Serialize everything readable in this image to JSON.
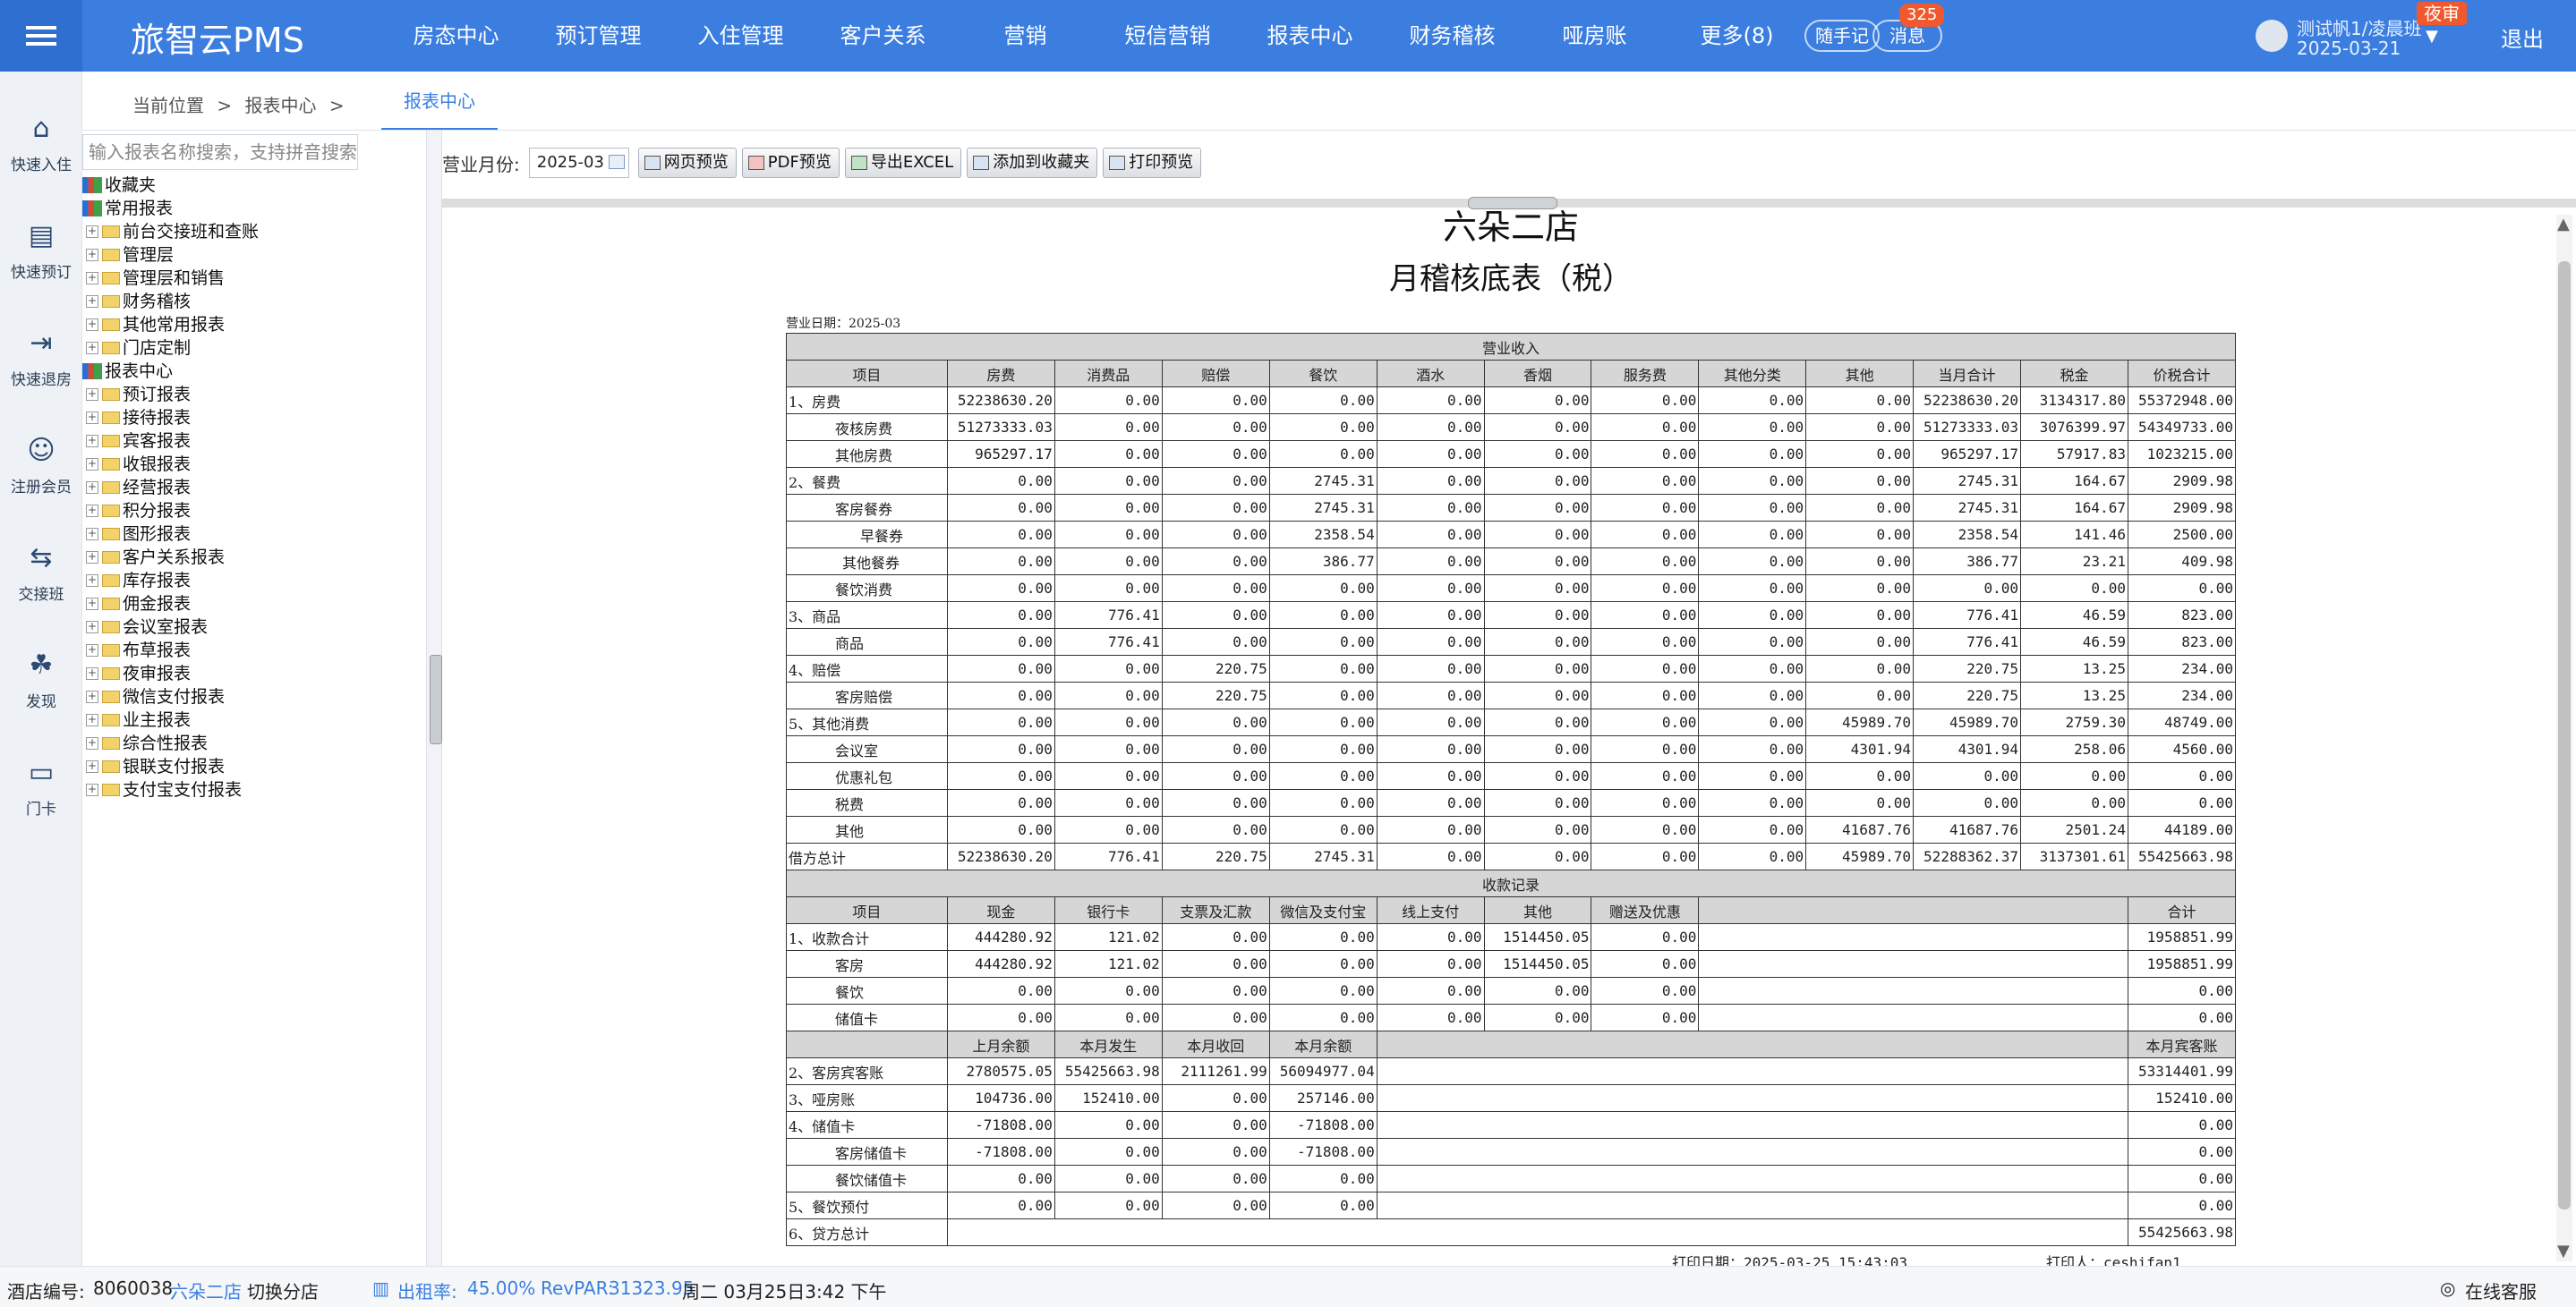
{
  "app": {
    "brand": "旅智云PMS"
  },
  "topnav": [
    "房态中心",
    "预订管理",
    "入住管理",
    "客户关系",
    "营销",
    "短信营销",
    "报表中心",
    "财务稽核",
    "哑房账",
    "更多(8)"
  ],
  "top_right": {
    "memo": "随手记",
    "messages": "消息",
    "message_count": "325",
    "user": "测试帆1/凌晨班",
    "date": "2025-03-21",
    "night_audit": "夜审",
    "logout": "退出"
  },
  "sidebar": [
    "快速入住",
    "快速预订",
    "快速退房",
    "注册会员",
    "交接班",
    "发现",
    "门卡"
  ],
  "breadcrumb": {
    "prefix": "当前位置",
    "sep1": ">",
    "crumb": "报表中心",
    "sep2": ">"
  },
  "tab": "报表中心",
  "tree": {
    "search_placeholder": "输入报表名称搜索，支持拼音搜索",
    "nodes": [
      {
        "label": "收藏夹",
        "level": 0,
        "type": "book"
      },
      {
        "label": "常用报表",
        "level": 0,
        "type": "book"
      },
      {
        "label": "前台交接班和查账",
        "level": 1
      },
      {
        "label": "管理层",
        "level": 1
      },
      {
        "label": "管理层和销售",
        "level": 1
      },
      {
        "label": "财务稽核",
        "level": 1
      },
      {
        "label": "其他常用报表",
        "level": 1
      },
      {
        "label": "门店定制",
        "level": 1
      },
      {
        "label": "报表中心",
        "level": 0,
        "type": "book"
      },
      {
        "label": "预订报表",
        "level": 1
      },
      {
        "label": "接待报表",
        "level": 1
      },
      {
        "label": "宾客报表",
        "level": 1
      },
      {
        "label": "收银报表",
        "level": 1
      },
      {
        "label": "经营报表",
        "level": 1
      },
      {
        "label": "积分报表",
        "level": 1
      },
      {
        "label": "图形报表",
        "level": 1
      },
      {
        "label": "客户关系报表",
        "level": 1
      },
      {
        "label": "库存报表",
        "level": 1
      },
      {
        "label": "佣金报表",
        "level": 1
      },
      {
        "label": "会议室报表",
        "level": 1
      },
      {
        "label": "布草报表",
        "level": 1
      },
      {
        "label": "夜审报表",
        "level": 1
      },
      {
        "label": "微信支付报表",
        "level": 1
      },
      {
        "label": "业主报表",
        "level": 1
      },
      {
        "label": "综合性报表",
        "level": 1
      },
      {
        "label": "银联支付报表",
        "level": 1
      },
      {
        "label": "支付宝支付报表",
        "level": 1
      }
    ]
  },
  "toolbar": {
    "month_label": "营业月份:",
    "month_value": "2025-03",
    "buttons": [
      "网页预览",
      "PDF预览",
      "导出EXCEL",
      "添加到收藏夹",
      "打印预览"
    ]
  },
  "report": {
    "hotel": "六朵二店",
    "title": "月稽核底表（税）",
    "date_line": "营业日期：2025-03",
    "income_section": "营业收入",
    "income_headers": [
      "项目",
      "房费",
      "消费品",
      "赔偿",
      "餐饮",
      "酒水",
      "香烟",
      "服务费",
      "其他分类",
      "其他",
      "当月合计",
      "税金",
      "价税合计"
    ],
    "income_rows": [
      {
        "cls": "",
        "cells": [
          "1、房费",
          "52238630.20",
          "0.00",
          "0.00",
          "0.00",
          "0.00",
          "0.00",
          "0.00",
          "0.00",
          "0.00",
          "52238630.20",
          "3134317.80",
          "55372948.00"
        ]
      },
      {
        "cls": "i1",
        "cells": [
          "夜核房费",
          "51273333.03",
          "0.00",
          "0.00",
          "0.00",
          "0.00",
          "0.00",
          "0.00",
          "0.00",
          "0.00",
          "51273333.03",
          "3076399.97",
          "54349733.00"
        ]
      },
      {
        "cls": "i1",
        "cells": [
          "其他房费",
          "965297.17",
          "0.00",
          "0.00",
          "0.00",
          "0.00",
          "0.00",
          "0.00",
          "0.00",
          "0.00",
          "965297.17",
          "57917.83",
          "1023215.00"
        ]
      },
      {
        "cls": "",
        "cells": [
          "2、餐费",
          "0.00",
          "0.00",
          "0.00",
          "2745.31",
          "0.00",
          "0.00",
          "0.00",
          "0.00",
          "0.00",
          "2745.31",
          "164.67",
          "2909.98"
        ]
      },
      {
        "cls": "i1",
        "cells": [
          "客房餐券",
          "0.00",
          "0.00",
          "0.00",
          "2745.31",
          "0.00",
          "0.00",
          "0.00",
          "0.00",
          "0.00",
          "2745.31",
          "164.67",
          "2909.98"
        ]
      },
      {
        "cls": "i2",
        "cells": [
          "早餐券",
          "0.00",
          "0.00",
          "0.00",
          "2358.54",
          "0.00",
          "0.00",
          "0.00",
          "0.00",
          "0.00",
          "2358.54",
          "141.46",
          "2500.00"
        ]
      },
      {
        "cls": "i3",
        "cells": [
          "其他餐券",
          "0.00",
          "0.00",
          "0.00",
          "386.77",
          "0.00",
          "0.00",
          "0.00",
          "0.00",
          "0.00",
          "386.77",
          "23.21",
          "409.98"
        ]
      },
      {
        "cls": "i1",
        "cells": [
          "餐饮消费",
          "0.00",
          "0.00",
          "0.00",
          "0.00",
          "0.00",
          "0.00",
          "0.00",
          "0.00",
          "0.00",
          "0.00",
          "0.00",
          "0.00"
        ]
      },
      {
        "cls": "",
        "cells": [
          "3、商品",
          "0.00",
          "776.41",
          "0.00",
          "0.00",
          "0.00",
          "0.00",
          "0.00",
          "0.00",
          "0.00",
          "776.41",
          "46.59",
          "823.00"
        ]
      },
      {
        "cls": "i1",
        "cells": [
          "商品",
          "0.00",
          "776.41",
          "0.00",
          "0.00",
          "0.00",
          "0.00",
          "0.00",
          "0.00",
          "0.00",
          "776.41",
          "46.59",
          "823.00"
        ]
      },
      {
        "cls": "",
        "cells": [
          "4、赔偿",
          "0.00",
          "0.00",
          "220.75",
          "0.00",
          "0.00",
          "0.00",
          "0.00",
          "0.00",
          "0.00",
          "220.75",
          "13.25",
          "234.00"
        ]
      },
      {
        "cls": "i1",
        "cells": [
          "客房赔偿",
          "0.00",
          "0.00",
          "220.75",
          "0.00",
          "0.00",
          "0.00",
          "0.00",
          "0.00",
          "0.00",
          "220.75",
          "13.25",
          "234.00"
        ]
      },
      {
        "cls": "",
        "cells": [
          "5、其他消费",
          "0.00",
          "0.00",
          "0.00",
          "0.00",
          "0.00",
          "0.00",
          "0.00",
          "0.00",
          "45989.70",
          "45989.70",
          "2759.30",
          "48749.00"
        ]
      },
      {
        "cls": "i1",
        "cells": [
          "会议室",
          "0.00",
          "0.00",
          "0.00",
          "0.00",
          "0.00",
          "0.00",
          "0.00",
          "0.00",
          "4301.94",
          "4301.94",
          "258.06",
          "4560.00"
        ]
      },
      {
        "cls": "i1",
        "cells": [
          "优惠礼包",
          "0.00",
          "0.00",
          "0.00",
          "0.00",
          "0.00",
          "0.00",
          "0.00",
          "0.00",
          "0.00",
          "0.00",
          "0.00",
          "0.00"
        ]
      },
      {
        "cls": "i1",
        "cells": [
          "税费",
          "0.00",
          "0.00",
          "0.00",
          "0.00",
          "0.00",
          "0.00",
          "0.00",
          "0.00",
          "0.00",
          "0.00",
          "0.00",
          "0.00"
        ]
      },
      {
        "cls": "i1",
        "cells": [
          "其他",
          "0.00",
          "0.00",
          "0.00",
          "0.00",
          "0.00",
          "0.00",
          "0.00",
          "0.00",
          "41687.76",
          "41687.76",
          "2501.24",
          "44189.00"
        ]
      },
      {
        "cls": "",
        "cells": [
          "借方总计",
          "52238630.20",
          "776.41",
          "220.75",
          "2745.31",
          "0.00",
          "0.00",
          "0.00",
          "0.00",
          "45989.70",
          "52288362.37",
          "3137301.61",
          "55425663.98"
        ]
      }
    ],
    "payment_section": "收款记录",
    "payment_headers": [
      "项目",
      "现金",
      "银行卡",
      "支票及汇款",
      "微信及支付宝",
      "线上支付",
      "其他",
      "赠送及优惠",
      "合计"
    ],
    "payment_rows": [
      {
        "cls": "",
        "cells": [
          "1、收款合计",
          "444280.92",
          "121.02",
          "0.00",
          "0.00",
          "0.00",
          "1514450.05",
          "0.00",
          "1958851.99"
        ]
      },
      {
        "cls": "i1",
        "cells": [
          "客房",
          "444280.92",
          "121.02",
          "0.00",
          "0.00",
          "0.00",
          "1514450.05",
          "0.00",
          "1958851.99"
        ]
      },
      {
        "cls": "i1",
        "cells": [
          "餐饮",
          "0.00",
          "0.00",
          "0.00",
          "0.00",
          "0.00",
          "0.00",
          "0.00",
          "0.00"
        ]
      },
      {
        "cls": "i1",
        "cells": [
          "储值卡",
          "0.00",
          "0.00",
          "0.00",
          "0.00",
          "0.00",
          "0.00",
          "0.00",
          "0.00"
        ]
      }
    ],
    "balance_headers": [
      "上月余额",
      "本月发生",
      "本月收回",
      "本月余额",
      "本月宾客账"
    ],
    "balance_rows": [
      {
        "cls": "",
        "cells": [
          "2、客房宾客账",
          "2780575.05",
          "55425663.98",
          "2111261.99",
          "56094977.04",
          "53314401.99"
        ]
      },
      {
        "cls": "",
        "cells": [
          "3、哑房账",
          "104736.00",
          "152410.00",
          "0.00",
          "257146.00",
          "152410.00"
        ]
      },
      {
        "cls": "",
        "cells": [
          "4、储值卡",
          "-71808.00",
          "0.00",
          "0.00",
          "-71808.00",
          "0.00"
        ]
      },
      {
        "cls": "i1",
        "cells": [
          "客房储值卡",
          "-71808.00",
          "0.00",
          "0.00",
          "-71808.00",
          "0.00"
        ]
      },
      {
        "cls": "i1",
        "cells": [
          "餐饮储值卡",
          "0.00",
          "0.00",
          "0.00",
          "0.00",
          "0.00"
        ]
      },
      {
        "cls": "",
        "cells": [
          "5、餐饮预付",
          "0.00",
          "0.00",
          "0.00",
          "0.00",
          "0.00"
        ]
      }
    ],
    "credit_total": {
      "label": "6、贷方总计",
      "value": "55425663.98"
    },
    "print_date": "打印日期：2025-03-25 15:43:03",
    "print_user": "打印人：ceshifan1"
  },
  "statusbar": {
    "hotel_no_label": "酒店编号:",
    "hotel_no": "8060038",
    "hotel_name": "六朵二店",
    "switch": "切换分店",
    "occ_label": "出租率:",
    "occ_value": "45.00%",
    "revpar_label": "RevPAR:",
    "revpar_value": "31323.95",
    "datetime": "周二 03月25日3:42 下午",
    "support": "在线客服"
  }
}
